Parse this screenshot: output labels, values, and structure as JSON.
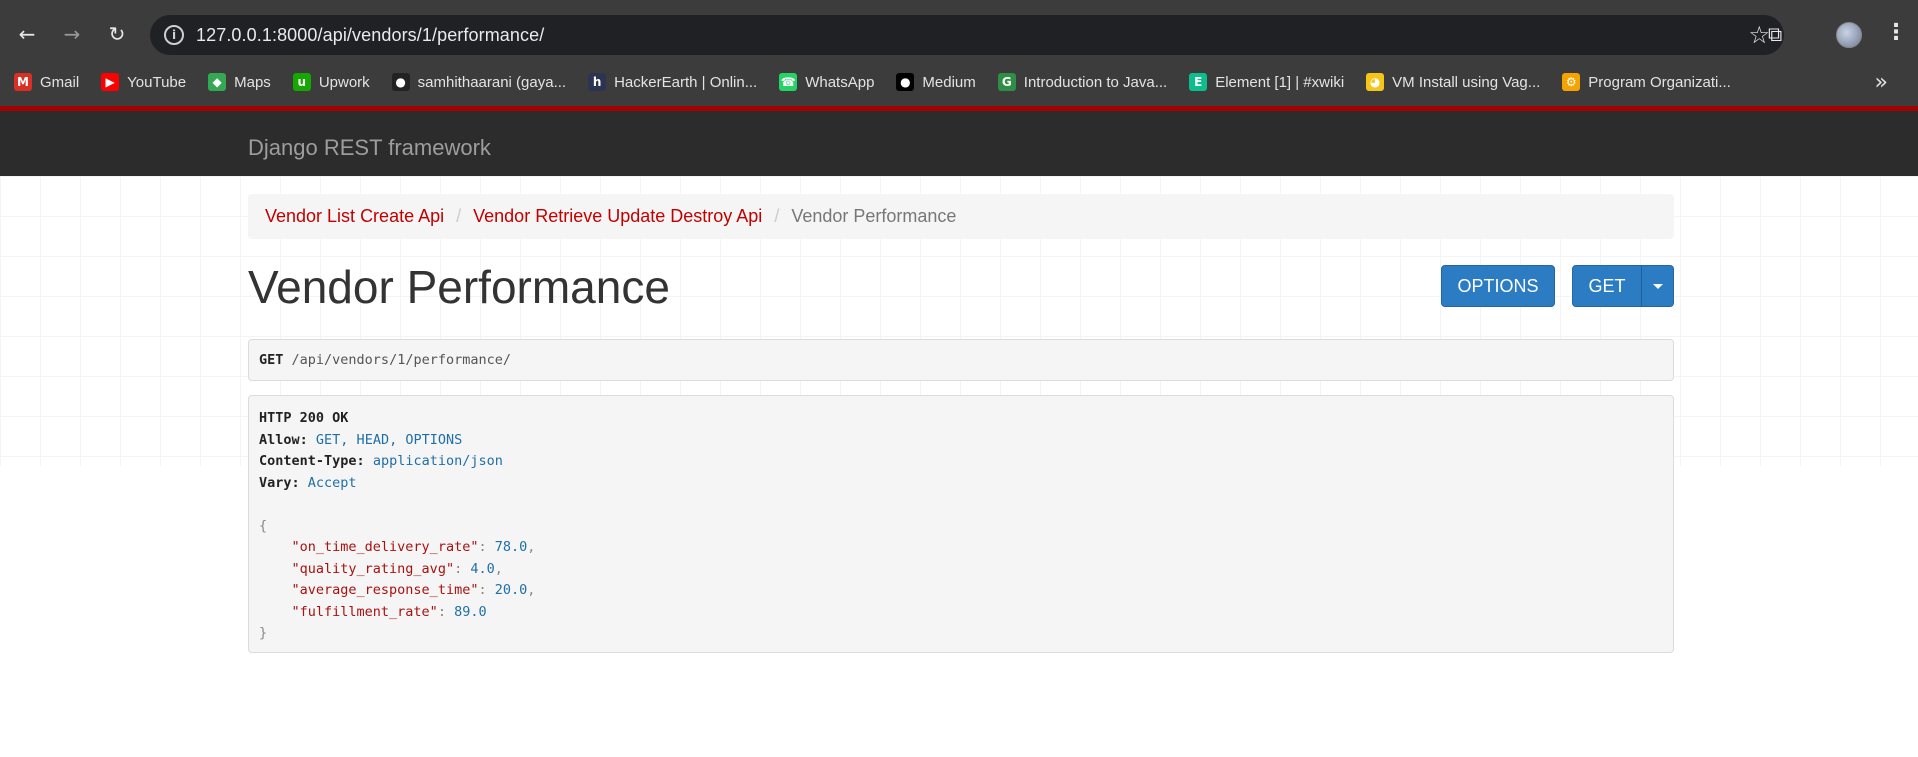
{
  "browser": {
    "url": "127.0.0.1:8000/api/vendors/1/performance/",
    "bookmarks": [
      {
        "label": "Gmail",
        "icon": "gmail-icon",
        "color": "#d93025"
      },
      {
        "label": "YouTube",
        "icon": "youtube-icon",
        "color": "#ff0000"
      },
      {
        "label": "Maps",
        "icon": "maps-icon",
        "color": "#34a853"
      },
      {
        "label": "Upwork",
        "icon": "upwork-icon",
        "color": "#14a800"
      },
      {
        "label": "samhithaarani (gaya...",
        "icon": "github-icon",
        "color": "#222222"
      },
      {
        "label": "HackerEarth | Onlin...",
        "icon": "hackerearth-icon",
        "color": "#2c3454"
      },
      {
        "label": "WhatsApp",
        "icon": "whatsapp-icon",
        "color": "#25d366"
      },
      {
        "label": "Medium",
        "icon": "medium-icon",
        "color": "#000000"
      },
      {
        "label": "Introduction to Java...",
        "icon": "geeksforgeeks-icon",
        "color": "#2f8d46"
      },
      {
        "label": "Element [1] | #xwiki",
        "icon": "element-icon",
        "color": "#0dbd8b"
      },
      {
        "label": "VM Install using Vag...",
        "icon": "duck-icon",
        "color": "#f5c518"
      },
      {
        "label": "Program Organizati...",
        "icon": "gear-sun-icon",
        "color": "#f4a300"
      }
    ]
  },
  "drf": {
    "brand": "Django REST framework",
    "breadcrumb": [
      "Vendor List Create Api",
      "Vendor Retrieve Update Destroy Api",
      "Vendor Performance"
    ],
    "title": "Vendor Performance",
    "buttons": {
      "options": "OPTIONS",
      "get": "GET"
    },
    "request": {
      "method": "GET",
      "path": "/api/vendors/1/performance/"
    },
    "response": {
      "status": "HTTP 200 OK",
      "headers": [
        {
          "name": "Allow:",
          "value": "GET, HEAD, OPTIONS"
        },
        {
          "name": "Content-Type:",
          "value": "application/json"
        },
        {
          "name": "Vary:",
          "value": "Accept"
        }
      ],
      "body": [
        {
          "key": "\"on_time_delivery_rate\"",
          "value": "78.0",
          "comma": ","
        },
        {
          "key": "\"quality_rating_avg\"",
          "value": "4.0",
          "comma": ","
        },
        {
          "key": "\"average_response_time\"",
          "value": "20.0",
          "comma": ","
        },
        {
          "key": "\"fulfillment_rate\"",
          "value": "89.0",
          "comma": ""
        }
      ]
    }
  },
  "colors": {
    "accent": "#2c7cc3",
    "navbar": "#2c2c2c",
    "navbar_border": "#a30000",
    "link": "#c20000"
  }
}
